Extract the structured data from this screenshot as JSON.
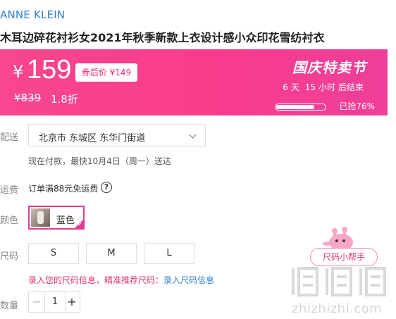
{
  "product": {
    "brand": "ANNE KLEIN",
    "title": "木耳边碎花衬衫女2021年秋季新款上衣设计感小众印花雪纺衬衣"
  },
  "price_banner": {
    "currency": "¥",
    "price": "159",
    "coupon_label": "券后价 ¥149",
    "original_price": "¥839",
    "discount": "1.8折",
    "promo_title": "国庆特卖节",
    "countdown": {
      "days": "6",
      "days_unit": "天",
      "hours": "15",
      "hours_unit": "小时",
      "suffix": "后结束"
    },
    "sold_label": "已抢76%",
    "sold_fraction": 0.76,
    "accent_color": "#f9468f"
  },
  "delivery": {
    "label": "配送",
    "address": "北京市 东城区 东华门街道",
    "note": "现在付款，最快10月4日（周一）送达"
  },
  "freight": {
    "label": "运费",
    "text": "订单满88元免运费",
    "help_symbol": "?"
  },
  "color": {
    "label": "颜色",
    "selected": "蓝色"
  },
  "size": {
    "label": "尺码",
    "options": [
      "S",
      "M",
      "L"
    ],
    "hint_warn": "录入您的尺码信息，精准推荐尺码：",
    "hint_link": "录入尺码信息",
    "helper_button": "尺码小帮手"
  },
  "quantity": {
    "label": "数量",
    "value": "1",
    "minus": "−",
    "plus": "+"
  },
  "watermark": {
    "logo_text": "值|值|值",
    "url": "zhizhizhi.com"
  }
}
